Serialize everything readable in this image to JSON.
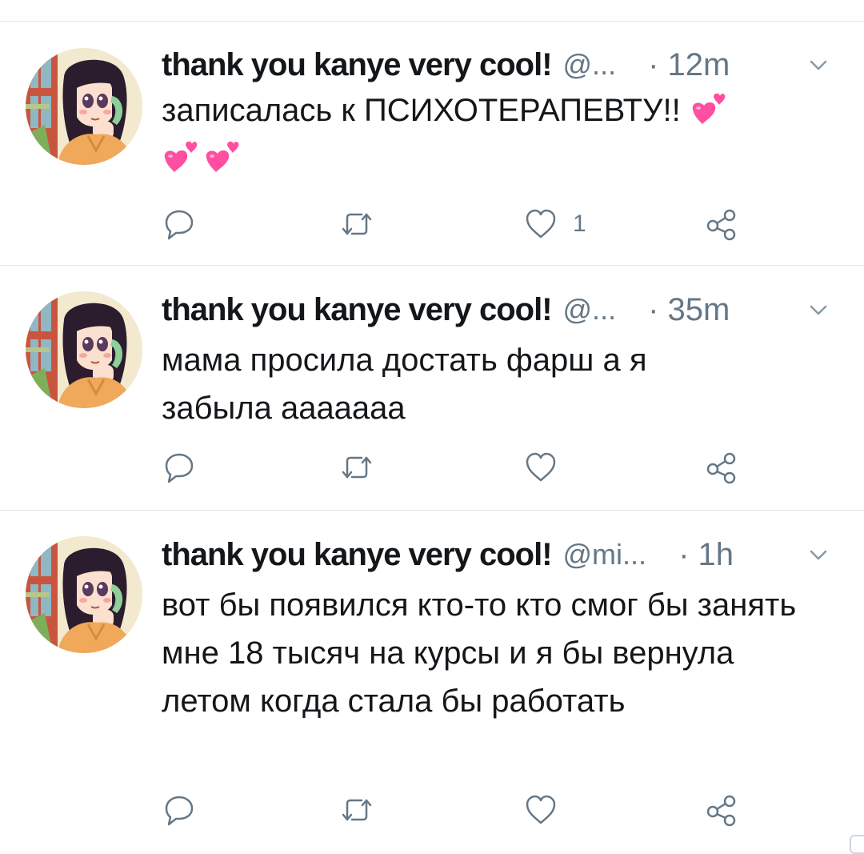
{
  "colors": {
    "text": "#14171a",
    "secondary": "#657786",
    "divider": "#e1e8ed",
    "heart_emoji": "#ff4fa0"
  },
  "tweets": [
    {
      "display_name": "thank you kanye very cool!",
      "handle": "@...",
      "time": "· 12m",
      "text": "записалась к ПСИХОТЕРАПЕВТУ!!",
      "emoji_icon": "two-hearts-emoji",
      "emoji_count": 3,
      "reply_count": "",
      "retweet_count": "",
      "like_count": "1"
    },
    {
      "display_name": "thank you kanye very cool!",
      "handle": "@...",
      "time": "· 35m",
      "text": "мама просила достать фарш а я забыла ааааааа",
      "reply_count": "",
      "retweet_count": "",
      "like_count": ""
    },
    {
      "display_name": "thank you kanye very cool!",
      "handle": "@mi...",
      "time": "· 1h",
      "text": "вот бы появился кто-то кто смог бы занять мне 18 тысяч на курсы и я бы вернула летом когда стала бы работать",
      "reply_count": "",
      "retweet_count": "",
      "like_count": ""
    }
  ],
  "icons": {
    "reply": "reply-icon",
    "retweet": "retweet-icon",
    "like": "heart-icon",
    "share": "share-icon",
    "menu": "chevron-down-icon"
  }
}
